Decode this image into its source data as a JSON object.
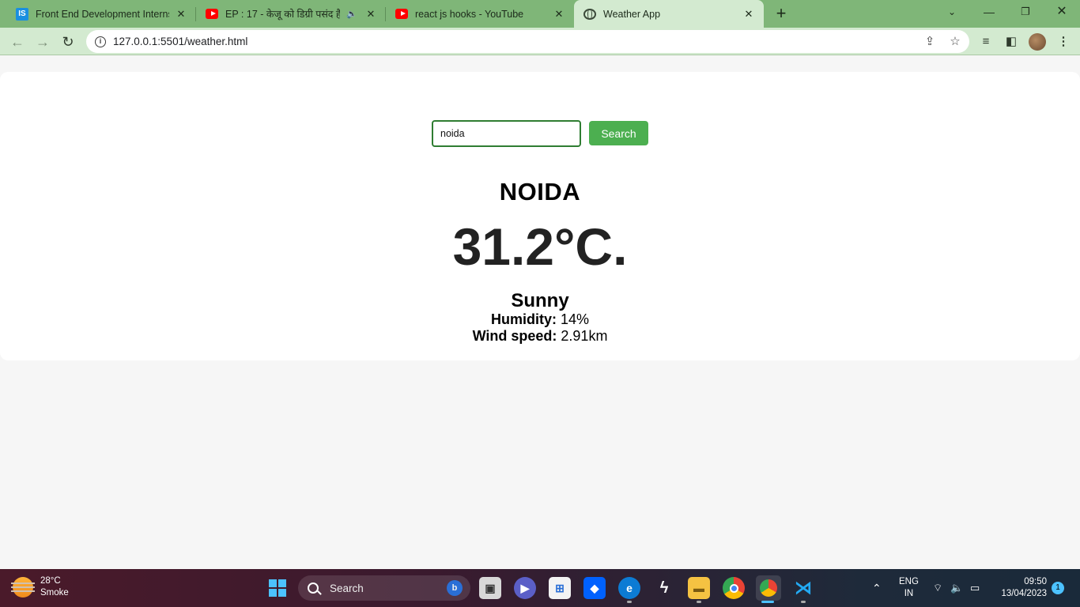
{
  "browser": {
    "tabs": [
      {
        "title": "Front End Development Internship",
        "favicon": "internshala-icon"
      },
      {
        "title": "EP : 17 - केजू को डिग्री पसंद है | ",
        "favicon": "youtube-icon",
        "audio": true
      },
      {
        "title": "react js hooks - YouTube",
        "favicon": "youtube-icon"
      },
      {
        "title": "Weather App",
        "favicon": "globe-icon",
        "active": true
      }
    ],
    "url": "127.0.0.1:5501/weather.html"
  },
  "weather_app": {
    "search": {
      "value": "noida",
      "button_label": "Search"
    },
    "city": "NOIDA",
    "temperature": "31.2°C.",
    "condition": "Sunny",
    "humidity_label": "Humidity:",
    "humidity_value": " 14%",
    "wind_label": "Wind speed:",
    "wind_value": " 2.91km",
    "accent_color": "#4caf50"
  },
  "taskbar": {
    "weather_temp": "28°C",
    "weather_desc": "Smoke",
    "search_label": "Search",
    "lang_line1": "ENG",
    "lang_line2": "IN",
    "time": "09:50",
    "date": "13/04/2023",
    "notifications": "1"
  }
}
